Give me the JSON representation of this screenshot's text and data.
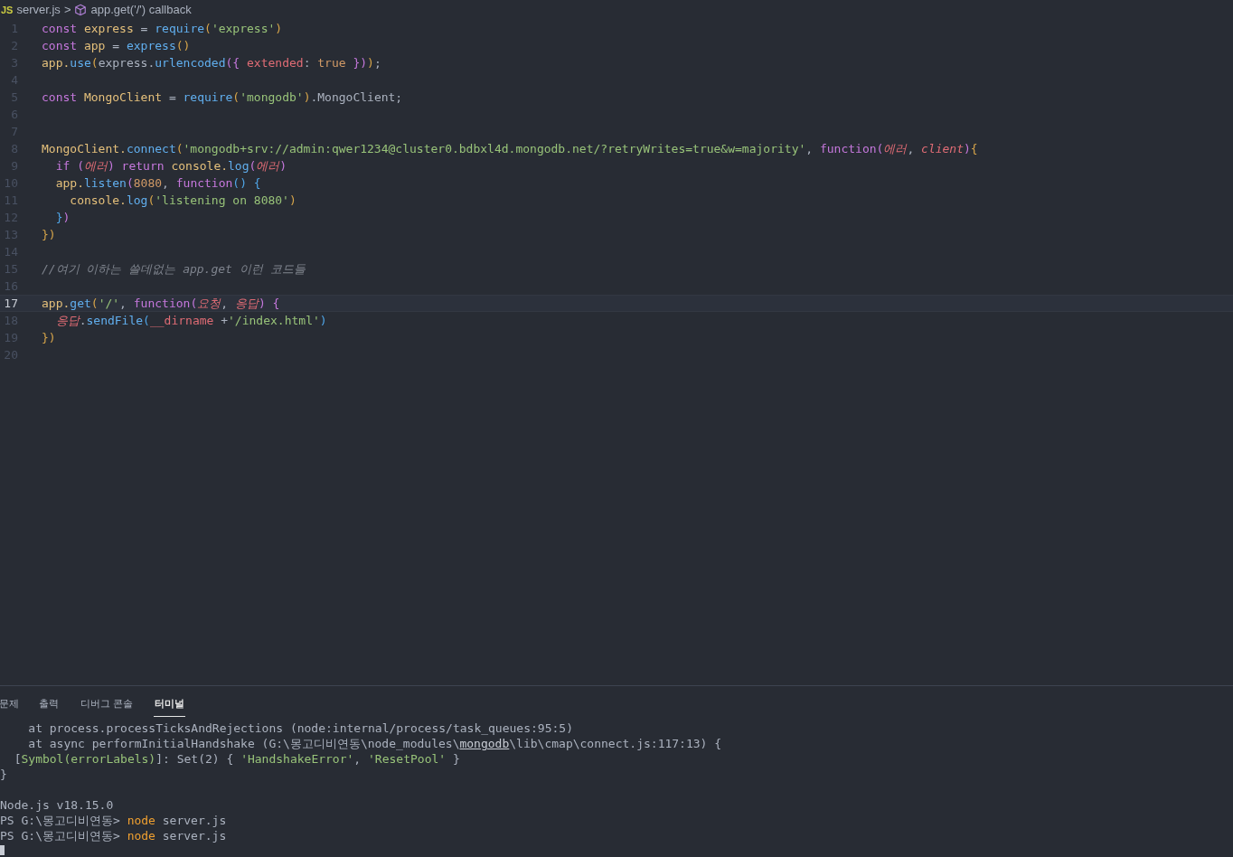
{
  "breadcrumb": {
    "file_icon": "JS",
    "file": "server.js",
    "separator": ">",
    "symbol": "app.get('/') callback"
  },
  "editor": {
    "lines": [
      {
        "number": "1",
        "selected": false,
        "tokens": [
          {
            "kind": "kw",
            "text": "const"
          },
          {
            "kind": "var",
            "text": " express"
          },
          {
            "kind": "plain",
            "text": " = "
          },
          {
            "kind": "fn",
            "text": "require"
          },
          {
            "kind": "b1",
            "text": "("
          },
          {
            "kind": "str",
            "text": "'express'"
          },
          {
            "kind": "b1",
            "text": ")"
          }
        ]
      },
      {
        "number": "2",
        "selected": false,
        "tokens": [
          {
            "kind": "kw",
            "text": "const"
          },
          {
            "kind": "var",
            "text": " app"
          },
          {
            "kind": "plain",
            "text": " = "
          },
          {
            "kind": "fn",
            "text": "express"
          },
          {
            "kind": "b1",
            "text": "()"
          }
        ]
      },
      {
        "number": "3",
        "selected": false,
        "tokens": [
          {
            "kind": "var",
            "text": "app."
          },
          {
            "kind": "fn",
            "text": "use"
          },
          {
            "kind": "b1",
            "text": "("
          },
          {
            "kind": "plain",
            "text": "express."
          },
          {
            "kind": "fn",
            "text": "urlencoded"
          },
          {
            "kind": "b2",
            "text": "({"
          },
          {
            "kind": "prop",
            "text": " extended"
          },
          {
            "kind": "plain",
            "text": ": "
          },
          {
            "kind": "bool",
            "text": "true"
          },
          {
            "kind": "b2",
            "text": " })"
          },
          {
            "kind": "b1",
            "text": ")"
          },
          {
            "kind": "plain",
            "text": ";"
          }
        ]
      },
      {
        "number": "4",
        "selected": false
      },
      {
        "number": "5",
        "selected": false,
        "tokens": [
          {
            "kind": "kw",
            "text": "const"
          },
          {
            "kind": "var",
            "text": " MongoClient"
          },
          {
            "kind": "plain",
            "text": " = "
          },
          {
            "kind": "fn",
            "text": "require"
          },
          {
            "kind": "b1",
            "text": "("
          },
          {
            "kind": "str",
            "text": "'mongodb'"
          },
          {
            "kind": "b1",
            "text": ")"
          },
          {
            "kind": "plain",
            "text": ".MongoClient;"
          }
        ]
      },
      {
        "number": "6",
        "selected": false
      },
      {
        "number": "7",
        "selected": false
      },
      {
        "number": "8",
        "selected": false,
        "tokens": [
          {
            "kind": "var",
            "text": "MongoClient."
          },
          {
            "kind": "fn",
            "text": "connect"
          },
          {
            "kind": "b1",
            "text": "("
          },
          {
            "kind": "str",
            "text": "'mongodb+srv://admin:qwer1234@cluster0.bdbxl4d.mongodb.net/?retryWrites=true&w=majority'"
          },
          {
            "kind": "plain",
            "text": ", "
          },
          {
            "kind": "kw",
            "text": "function"
          },
          {
            "kind": "b2",
            "text": "("
          },
          {
            "kind": "param",
            "text": "에러"
          },
          {
            "kind": "plain",
            "text": ", "
          },
          {
            "kind": "param",
            "text": "client"
          },
          {
            "kind": "b2",
            "text": ")"
          },
          {
            "kind": "b1",
            "text": "{"
          }
        ]
      },
      {
        "number": "9",
        "selected": false,
        "tokens": [
          {
            "kind": "kw",
            "text": "  if"
          },
          {
            "kind": "b2",
            "text": " ("
          },
          {
            "kind": "param",
            "text": "에러"
          },
          {
            "kind": "b2",
            "text": ")"
          },
          {
            "kind": "kw",
            "text": " return"
          },
          {
            "kind": "var",
            "text": " console."
          },
          {
            "kind": "fn",
            "text": "log"
          },
          {
            "kind": "b2",
            "text": "("
          },
          {
            "kind": "param",
            "text": "에러"
          },
          {
            "kind": "b2",
            "text": ")"
          }
        ]
      },
      {
        "number": "10",
        "selected": false,
        "tokens": [
          {
            "kind": "var",
            "text": "  app."
          },
          {
            "kind": "fn",
            "text": "listen"
          },
          {
            "kind": "b2",
            "text": "("
          },
          {
            "kind": "bool",
            "text": "8080"
          },
          {
            "kind": "plain",
            "text": ", "
          },
          {
            "kind": "kw",
            "text": "function"
          },
          {
            "kind": "b3",
            "text": "() {"
          }
        ]
      },
      {
        "number": "11",
        "selected": false,
        "tokens": [
          {
            "kind": "var",
            "text": "    console."
          },
          {
            "kind": "fn",
            "text": "log"
          },
          {
            "kind": "b1",
            "text": "("
          },
          {
            "kind": "str",
            "text": "'listening on 8080'"
          },
          {
            "kind": "b1",
            "text": ")"
          }
        ]
      },
      {
        "number": "12",
        "selected": false,
        "tokens": [
          {
            "kind": "b3",
            "text": "  }"
          },
          {
            "kind": "b2",
            "text": ")"
          }
        ]
      },
      {
        "number": "13",
        "selected": false,
        "tokens": [
          {
            "kind": "b1",
            "text": "})"
          }
        ]
      },
      {
        "number": "14",
        "selected": false
      },
      {
        "number": "15",
        "selected": false,
        "tokens": [
          {
            "kind": "comment",
            "text": "//여기 이하는 쓸데없는 app.get 이런 코드들"
          }
        ]
      },
      {
        "number": "16",
        "selected": false
      },
      {
        "number": "17",
        "selected": true,
        "tokens": [
          {
            "kind": "var",
            "text": "app."
          },
          {
            "kind": "fn",
            "text": "get"
          },
          {
            "kind": "b1",
            "text": "("
          },
          {
            "kind": "str",
            "text": "'/'"
          },
          {
            "kind": "plain",
            "text": ", "
          },
          {
            "kind": "kw",
            "text": "function"
          },
          {
            "kind": "b2",
            "text": "("
          },
          {
            "kind": "param",
            "text": "요청"
          },
          {
            "kind": "plain",
            "text": ", "
          },
          {
            "kind": "param",
            "text": "응답"
          },
          {
            "kind": "b2",
            "text": ") {"
          }
        ]
      },
      {
        "number": "18",
        "selected": false,
        "tokens": [
          {
            "kind": "param",
            "text": "  응답"
          },
          {
            "kind": "plain",
            "text": "."
          },
          {
            "kind": "fn",
            "text": "sendFile"
          },
          {
            "kind": "b3",
            "text": "("
          },
          {
            "kind": "prop",
            "text": "__dirname"
          },
          {
            "kind": "plain",
            "text": " +"
          },
          {
            "kind": "str",
            "text": "'/index.html'"
          },
          {
            "kind": "b3",
            "text": ")"
          }
        ]
      },
      {
        "number": "19",
        "selected": false,
        "tokens": [
          {
            "kind": "b1",
            "text": "})"
          }
        ]
      },
      {
        "number": "20",
        "selected": false
      }
    ]
  },
  "panel": {
    "tabs": [
      {
        "label": "문제",
        "selected": false
      },
      {
        "label": "출력",
        "selected": false
      },
      {
        "label": "디버그 콘솔",
        "selected": false
      },
      {
        "label": "터미널",
        "selected": true
      }
    ],
    "terminal": [
      {
        "lines": [
          {
            "tokens": [
              {
                "kind": "plain",
                "text": "    at process.processTicksAndRejections (node:internal/process/task_queues:95:5)"
              }
            ]
          },
          {
            "tokens": [
              {
                "kind": "plain",
                "text": "    at async performInitialHandshake (G:\\몽고디비연동\\node_modules\\"
              },
              {
                "kind": "link",
                "text": "mongodb"
              },
              {
                "kind": "plain",
                "text": "\\lib\\cmap\\connect.js:117:13) {"
              }
            ]
          },
          {
            "tokens": [
              {
                "kind": "plain",
                "text": "  ["
              },
              {
                "kind": "str",
                "text": "Symbol(errorLabels)"
              },
              {
                "kind": "plain",
                "text": "]: Set(2) { "
              },
              {
                "kind": "str",
                "text": "'HandshakeError'"
              },
              {
                "kind": "plain",
                "text": ", "
              },
              {
                "kind": "str",
                "text": "'ResetPool'"
              },
              {
                "kind": "plain",
                "text": " }"
              }
            ]
          },
          {
            "tokens": [
              {
                "kind": "plain",
                "text": "}"
              }
            ]
          }
        ]
      },
      {
        "lines": [
          {
            "tokens": [
              {
                "kind": "plain",
                "text": "Node.js v18.15.0"
              }
            ]
          },
          {
            "tokens": [
              {
                "kind": "plain",
                "text": "PS G:\\몽고디비연동> "
              },
              {
                "kind": "cmd",
                "text": "node"
              },
              {
                "kind": "plain",
                "text": " server.js"
              }
            ]
          },
          {
            "tokens": [
              {
                "kind": "plain",
                "text": "PS G:\\몽고디비연동> "
              },
              {
                "kind": "cmd",
                "text": "node"
              },
              {
                "kind": "plain",
                "text": " server.js"
              }
            ]
          }
        ]
      }
    ]
  }
}
